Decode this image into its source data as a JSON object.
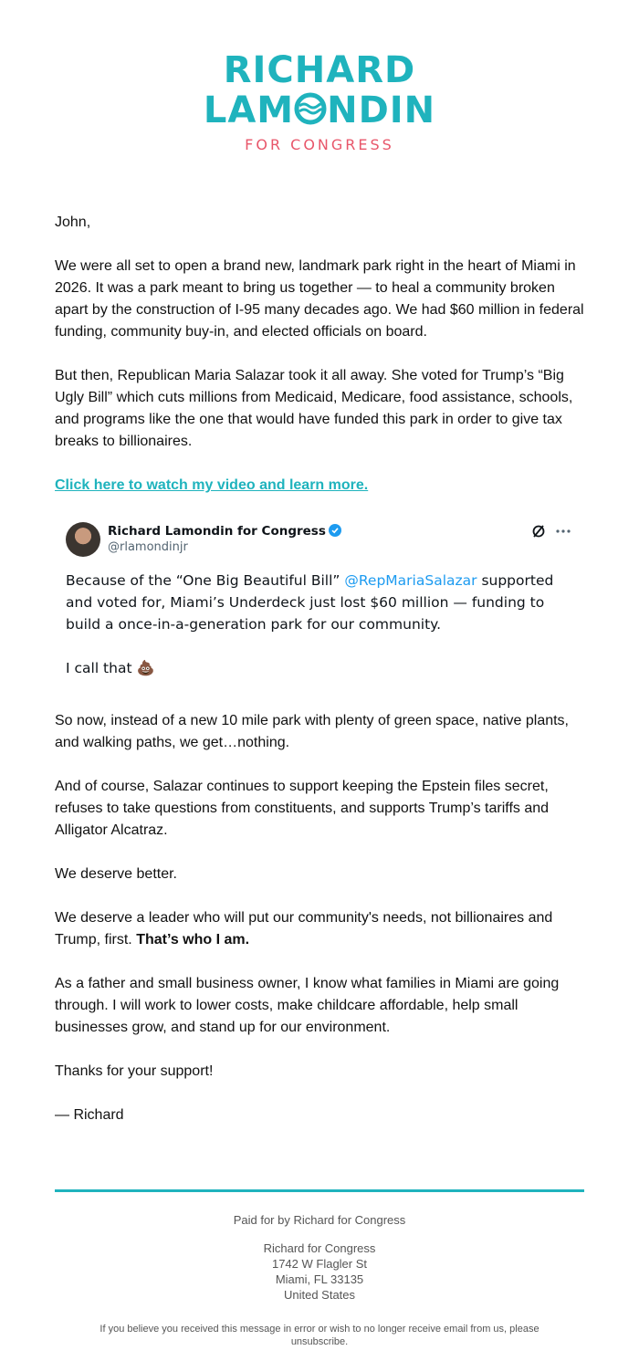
{
  "logo": {
    "line1": "RICHARD",
    "line2_pre": "LAM",
    "line2_post": "NDIN",
    "tagline": "FOR CONGRESS",
    "color_primary": "#1fb3bd",
    "color_accent": "#e8566a"
  },
  "greeting": "John,",
  "paragraphs": {
    "p1": "We were all set to open a brand new, landmark park right in the heart of Miami in 2026. It was a park meant to bring us together — to heal a community broken apart by the construction of I-95 many decades ago. We had $60 million in federal funding, community buy-in, and elected officials on board.",
    "p2": "But then, Republican Maria Salazar took it all away. She voted for Trump’s “Big Ugly Bill” which cuts millions from Medicaid, Medicare, food assistance, schools, and programs like the one that would have funded this park in order to give tax breaks to billionaires.",
    "cta_link": "Click here to watch my video and learn more.",
    "p3": "So now, instead of a new 10 mile park with plenty of green space, native plants, and walking paths, we get…nothing.",
    "p4": "And of course, Salazar continues to support keeping the Epstein files secret, refuses to take questions from constituents, and supports Trump’s tariffs and Alligator Alcatraz.",
    "p5": "We deserve better.",
    "p6_text": "We deserve a leader who will put our community's needs, not billionaires and Trump, first. ",
    "p6_bold": "That’s who I am.",
    "p7": "As a father and small business owner, I know what families in Miami are going through. I will work to lower costs, make childcare affordable, help small businesses grow, and stand up for our environment.",
    "p8": "Thanks for your support!",
    "signoff": "— Richard"
  },
  "tweet": {
    "name": "Richard Lamondin for Congress",
    "handle": "@rlamondinjr",
    "text_pre": "Because of the “One Big Beautiful Bill” ",
    "mention": "@RepMariaSalazar",
    "text_post": " supported and voted for, Miami’s Underdeck just lost $60 million — funding to build a once-in-a-generation park for our community.",
    "text2": "I call that",
    "emoji": "💩",
    "icons": [
      "verified-badge-icon",
      "x-logo-icon",
      "more-icon"
    ]
  },
  "footer": {
    "paid_for": "Paid for by Richard for Congress",
    "address": {
      "org": "Richard for Congress",
      "street": "1742 W Flagler St",
      "city": "Miami, FL 33135",
      "country": "United States"
    },
    "disclaimer": "If you believe you received this message in error or wish to no longer receive email from us, please",
    "unsubscribe": "unsubscribe."
  }
}
